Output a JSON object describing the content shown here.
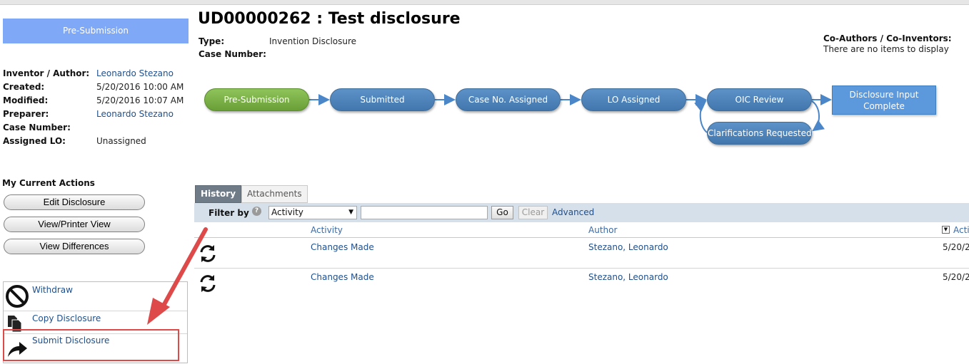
{
  "status_box": "Pre-Submission",
  "info": [
    {
      "label": "Inventor / Author:",
      "value": "Leonardo Stezano",
      "link": true
    },
    {
      "label": "Created:",
      "value": "5/20/2016 10:00 AM",
      "link": false
    },
    {
      "label": "Modified:",
      "value": "5/20/2016 10:07 AM",
      "link": false
    },
    {
      "label": "Preparer:",
      "value": "Leonardo Stezano",
      "link": true
    },
    {
      "label": "Case Number:",
      "value": "",
      "link": false
    },
    {
      "label": "Assigned LO:",
      "value": "Unassigned",
      "link": false
    }
  ],
  "actions": {
    "title": "My Current Actions",
    "buttons": [
      "Edit Disclosure",
      "View/Printer View",
      "View Differences"
    ],
    "menu": [
      "Withdraw",
      "Copy Disclosure",
      "Submit Disclosure"
    ]
  },
  "header": {
    "title": "UD00000262 : Test disclosure",
    "type_label": "Type:",
    "type_value": "Invention Disclosure",
    "case_label": "Case Number:",
    "case_value": "",
    "coauthors_title": "Co-Authors / Co-Inventors:",
    "coauthors_empty": "There are no items to display"
  },
  "workflow": {
    "nodes": [
      "Pre-Submission",
      "Submitted",
      "Case No. Assigned",
      "LO Assigned",
      "OIC Review",
      "Clarifications Requested"
    ],
    "final": "Disclosure Input Complete",
    "current": "Pre-Submission"
  },
  "tabs": [
    "History",
    "Attachments"
  ],
  "filter": {
    "label": "Filter by",
    "select_value": "Activity",
    "input_value": "",
    "go": "Go",
    "clear": "Clear",
    "advanced": "Advanced"
  },
  "table": {
    "columns": [
      "Activity",
      "Author",
      "Acti"
    ],
    "rows": [
      {
        "activity": "Changes Made",
        "author": "Stezano, Leonardo",
        "date": "5/20/2"
      },
      {
        "activity": "Changes Made",
        "author": "Stezano, Leonardo",
        "date": "5/20/2"
      }
    ]
  },
  "colors": {
    "status_box": "#7fa9f6",
    "node_blue": "#4a80b8",
    "node_green": "#7ab146",
    "annotation_red": "#de4a4a",
    "link": "#1e4f8c"
  },
  "icons": {
    "withdraw": "no-entry-icon",
    "copy": "copy-documents-icon",
    "submit": "forward-arrow-icon",
    "history_row": "refresh-icon",
    "help": "help-icon",
    "sort": "sort-toggle-icon"
  }
}
